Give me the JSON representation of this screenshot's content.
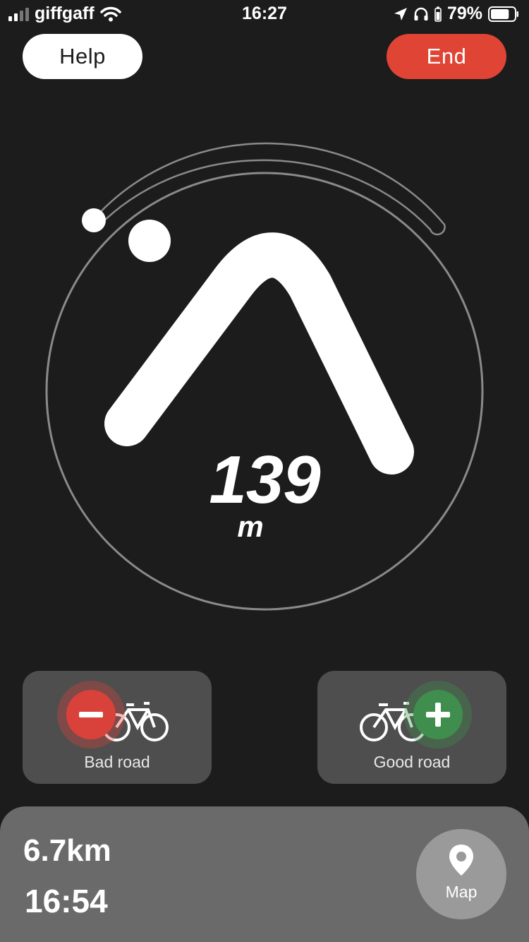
{
  "status_bar": {
    "carrier": "giffgaff",
    "time": "16:27",
    "battery": "79%",
    "battery_level": 0.79
  },
  "header": {
    "help_label": "Help",
    "end_label": "End"
  },
  "navigation": {
    "distance": "139",
    "unit": "m",
    "turn_icon": "sharp-turn-arrow-icon"
  },
  "feedback": {
    "bad_label": "Bad road",
    "good_label": "Good road"
  },
  "trip": {
    "distance": "6.7km",
    "eta": "16:54",
    "map_label": "Map"
  },
  "colors": {
    "background": "#1c1c1c",
    "end": "#e04434",
    "bad": "#d9423a",
    "good": "#3f8e4d",
    "panel": "#6a6a6a"
  }
}
